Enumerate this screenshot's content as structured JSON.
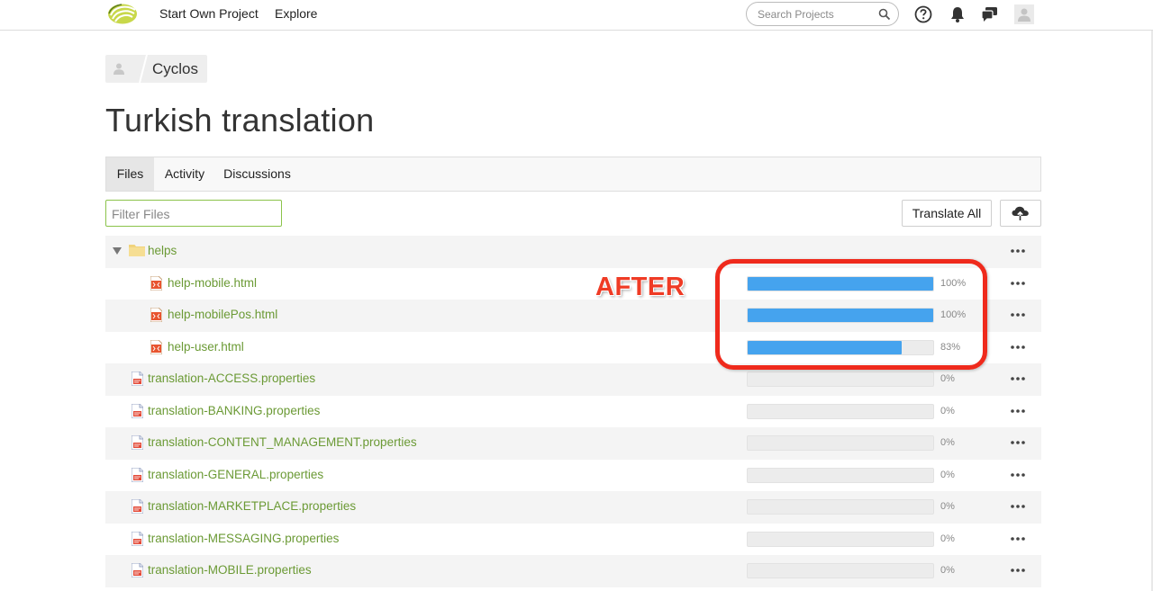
{
  "nav": {
    "links": [
      "Start Own Project",
      "Explore"
    ],
    "search_placeholder": "Search Projects",
    "icons": [
      "logo-icon",
      "search-icon",
      "help-icon",
      "bell-icon",
      "chat-icon",
      "user-avatar-icon"
    ]
  },
  "breadcrumb": {
    "label": "Cyclos"
  },
  "page": {
    "title": "Turkish translation"
  },
  "tabs": [
    {
      "label": "Files",
      "active": true
    },
    {
      "label": "Activity",
      "active": false
    },
    {
      "label": "Discussions",
      "active": false
    }
  ],
  "toolbar": {
    "filter_placeholder": "Filter Files",
    "translate_all_label": "Translate All",
    "upload_icon": "cloud-upload-icon"
  },
  "folder": {
    "name": "helps",
    "expanded": true
  },
  "files": [
    {
      "name": "help-mobile.html",
      "type": "html",
      "in_folder": true,
      "progress": 100,
      "progress_label": "100%"
    },
    {
      "name": "help-mobilePos.html",
      "type": "html",
      "in_folder": true,
      "progress": 100,
      "progress_label": "100%"
    },
    {
      "name": "help-user.html",
      "type": "html",
      "in_folder": true,
      "progress": 83,
      "progress_label": "83%"
    },
    {
      "name": "translation-ACCESS.properties",
      "type": "properties",
      "in_folder": false,
      "progress": 0,
      "progress_label": "0%"
    },
    {
      "name": "translation-BANKING.properties",
      "type": "properties",
      "in_folder": false,
      "progress": 0,
      "progress_label": "0%"
    },
    {
      "name": "translation-CONTENT_MANAGEMENT.properties",
      "type": "properties",
      "in_folder": false,
      "progress": 0,
      "progress_label": "0%"
    },
    {
      "name": "translation-GENERAL.properties",
      "type": "properties",
      "in_folder": false,
      "progress": 0,
      "progress_label": "0%"
    },
    {
      "name": "translation-MARKETPLACE.properties",
      "type": "properties",
      "in_folder": false,
      "progress": 0,
      "progress_label": "0%"
    },
    {
      "name": "translation-MESSAGING.properties",
      "type": "properties",
      "in_folder": false,
      "progress": 0,
      "progress_label": "0%"
    },
    {
      "name": "translation-MOBILE.properties",
      "type": "properties",
      "in_folder": false,
      "progress": 0,
      "progress_label": "0%"
    }
  ],
  "annotation": {
    "text": "AFTER",
    "color": "#ef2a1c"
  },
  "colors": {
    "accent_green": "#6b9a35",
    "progress_blue": "#45a3ee",
    "filter_border": "#8bc34a"
  }
}
